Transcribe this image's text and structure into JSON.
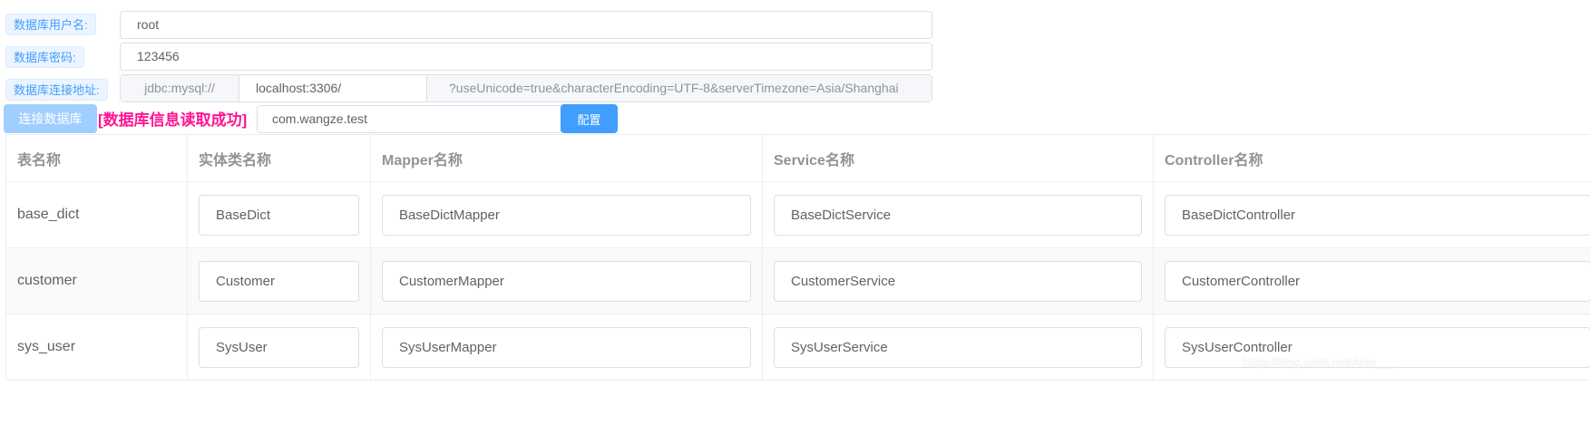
{
  "form": {
    "username_label": "数据库用户名:",
    "username_value": "root",
    "password_label": "数据库密码:",
    "password_value": "123456",
    "url_label": "数据库连接地址:",
    "url_prefix": "jdbc:mysql://",
    "url_host": "localhost:3306/",
    "url_suffix": "?useUnicode=true&characterEncoding=UTF-8&serverTimezone=Asia/Shanghai"
  },
  "actions": {
    "connect_label": "连接数据库",
    "status_message": "[数据库信息读取成功]",
    "package_value": "com.wangze.test",
    "config_label": "配置"
  },
  "table": {
    "headers": [
      "表名称",
      "实体类名称",
      "Mapper名称",
      "Service名称",
      "Controller名称"
    ],
    "rows": [
      {
        "table": "base_dict",
        "entity": "BaseDict",
        "mapper": "BaseDictMapper",
        "service": "BaseDictService",
        "controller": "BaseDictController"
      },
      {
        "table": "customer",
        "entity": "Customer",
        "mapper": "CustomerMapper",
        "service": "CustomerService",
        "controller": "CustomerController"
      },
      {
        "table": "sys_user",
        "entity": "SysUser",
        "mapper": "SysUserMapper",
        "service": "SysUserService",
        "controller": "SysUserController"
      }
    ]
  },
  "watermark": "https://blog.csdn.net/Ares___"
}
